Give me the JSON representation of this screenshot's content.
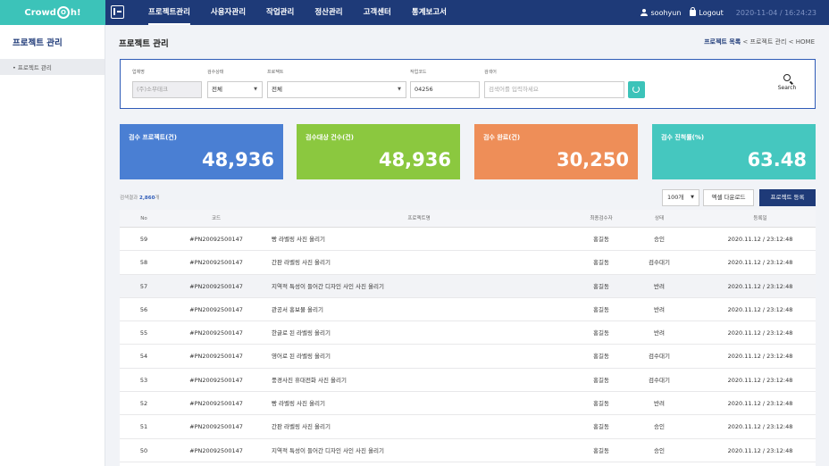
{
  "brand": {
    "pre": "Crowd",
    "o": "O",
    "post": "h!"
  },
  "nav": [
    "프로젝트관리",
    "사용자관리",
    "작업관리",
    "정산관리",
    "고객센터",
    "통계보고서"
  ],
  "user": {
    "name": "soohyun",
    "logout": "Logout",
    "datetime": "2020-11-04 / 16:24:23"
  },
  "sidebar": {
    "title": "프로젝트 관리",
    "items": [
      "프로젝트 관리"
    ]
  },
  "page": {
    "title": "프로젝트 관리"
  },
  "breadcrumb": {
    "first": "프로젝트 목록",
    "sep": "<",
    "second": "프로젝트 관리",
    "third": "HOME"
  },
  "filters": {
    "company": {
      "label": "업체명",
      "value": "(주)소무테크"
    },
    "status": {
      "label": "검수상태",
      "value": "전체"
    },
    "project": {
      "label": "프로젝트",
      "value": "전체"
    },
    "workcode": {
      "label": "작업코드",
      "value": "04256"
    },
    "keyword": {
      "label": "검색어",
      "placeholder": "검색어를 입력하세요"
    },
    "search_label": "Search"
  },
  "cards": [
    {
      "label": "검수 프로젝트(건)",
      "value": "48,936",
      "color": "#4a7fd3"
    },
    {
      "label": "검수대상 건수(건)",
      "value": "48,936",
      "color": "#8bc83f"
    },
    {
      "label": "검수 완료(건)",
      "value": "30,250",
      "color": "#ee8e58"
    },
    {
      "label": "검수 진척률(%)",
      "value": "63.48",
      "color": "#45c7bf"
    }
  ],
  "result": {
    "prefix": "검색결과",
    "count": "2,860",
    "suffix": "개"
  },
  "toolbar": {
    "page_size": "100개",
    "excel": "엑셀 다운로드",
    "register": "프로젝트 등록"
  },
  "table": {
    "headers": [
      "No",
      "코드",
      "프로젝트명",
      "최종검수자",
      "상태",
      "등록일"
    ],
    "rows": [
      [
        "59",
        "#PN20092500147",
        "빵 라벨링 사진 올리기",
        "홍길동",
        "승인",
        "2020.11.12 / 23:12:48"
      ],
      [
        "58",
        "#PN20092500147",
        "간판 라벨링 사진 올리기",
        "홍길동",
        "검수대기",
        "2020.11.12 / 23:12:48"
      ],
      [
        "57",
        "#PN20092500147",
        "지역적 특성이 들어간 디자인 사인 사진 올리기",
        "홍길동",
        "반려",
        "2020.11.12 / 23:12:48"
      ],
      [
        "56",
        "#PN20092500147",
        "관공서 홍보물 올리기",
        "홍길동",
        "반려",
        "2020.11.12 / 23:12:48"
      ],
      [
        "55",
        "#PN20092500147",
        "한글로 된 라벨링 올리기",
        "홍길동",
        "반려",
        "2020.11.12 / 23:12:48"
      ],
      [
        "54",
        "#PN20092500147",
        "영어로 된 라벨링 올리기",
        "홍길동",
        "검수대기",
        "2020.11.12 / 23:12:48"
      ],
      [
        "53",
        "#PN20092500147",
        "풍경사진 휴대전화 사진 올리기",
        "홍길동",
        "검수대기",
        "2020.11.12 / 23:12:48"
      ],
      [
        "52",
        "#PN20092500147",
        "빵 라벨링 사진 올리기",
        "홍길동",
        "반려",
        "2020.11.12 / 23:12:48"
      ],
      [
        "51",
        "#PN20092500147",
        "간판 라벨링 사진 올리기",
        "홍길동",
        "승인",
        "2020.11.12 / 23:12:48"
      ],
      [
        "50",
        "#PN20092500147",
        "지역적 특성이 들어간 디자인 사인 사진 올리기",
        "홍길동",
        "승인",
        "2020.11.12 / 23:12:48"
      ]
    ]
  }
}
